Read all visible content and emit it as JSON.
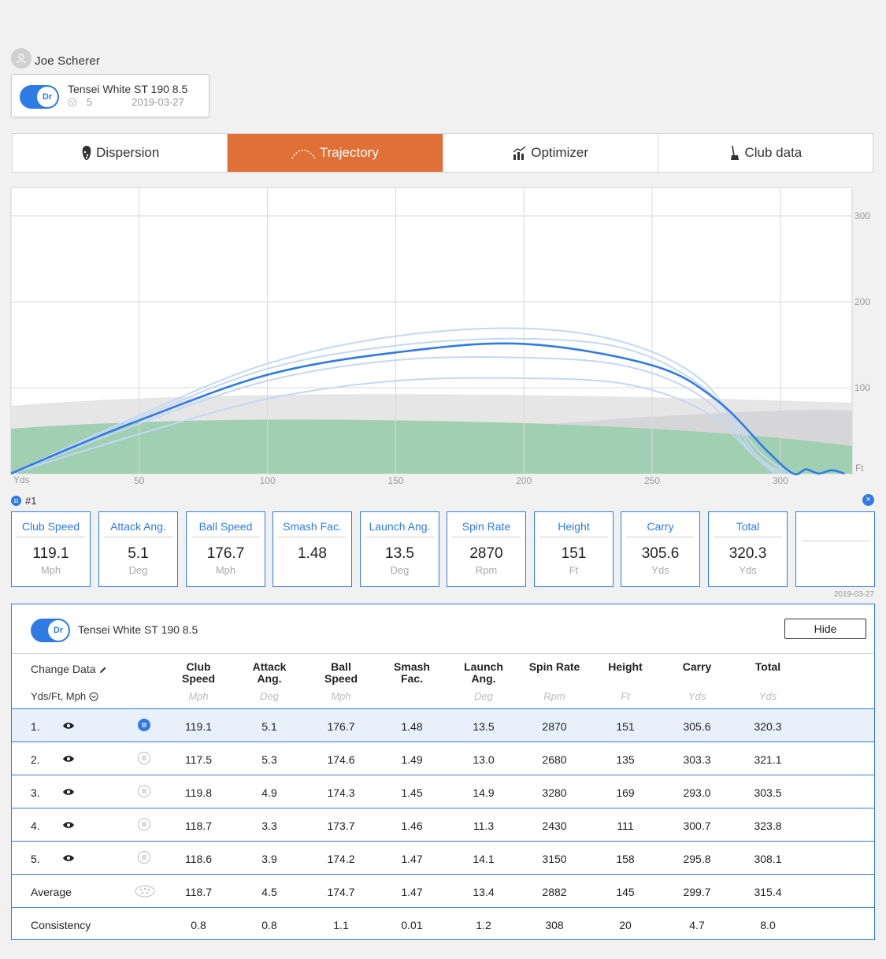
{
  "user": {
    "name": "Joe Scherer"
  },
  "club": {
    "toggle_label": "Dr",
    "name": "Tensei White ST 190 8.5",
    "shot_count": "5",
    "date": "2019-03-27"
  },
  "tabs": [
    {
      "label": "Dispersion",
      "active": false
    },
    {
      "label": "Trajectory",
      "active": true
    },
    {
      "label": "Optimizer",
      "active": false
    },
    {
      "label": "Club data",
      "active": false
    }
  ],
  "chart_data": {
    "type": "line",
    "x_unit_label": "Yds",
    "y_unit_label": "Ft",
    "x_ticks": [
      50,
      100,
      150,
      200,
      250,
      300
    ],
    "y_ticks": [
      100,
      200,
      300
    ],
    "xlim": [
      0,
      328
    ],
    "ylim": [
      0,
      333
    ],
    "highlight_color": "#2f7be6",
    "faded_color": "#c4d8f3",
    "series": [
      {
        "values": [
          [
            0,
            0
          ],
          [
            25,
            32
          ],
          [
            50,
            62
          ],
          [
            100,
            115
          ],
          [
            150,
            141
          ],
          [
            200,
            151
          ],
          [
            250,
            126
          ],
          [
            275,
            86
          ],
          [
            295,
            26
          ],
          [
            305,
            0
          ],
          [
            310,
            5
          ],
          [
            315,
            0
          ],
          [
            320,
            4
          ],
          [
            325,
            0
          ]
        ],
        "highlight": true
      },
      {
        "values": [
          [
            0,
            0
          ],
          [
            50,
            68
          ],
          [
            100,
            128
          ],
          [
            150,
            160
          ],
          [
            200,
            169
          ],
          [
            240,
            152
          ],
          [
            270,
            107
          ],
          [
            290,
            24
          ],
          [
            302,
            0
          ]
        ],
        "highlight": false
      },
      {
        "values": [
          [
            0,
            0
          ],
          [
            50,
            65
          ],
          [
            100,
            122
          ],
          [
            150,
            149
          ],
          [
            200,
            157
          ],
          [
            240,
            145
          ],
          [
            270,
            100
          ],
          [
            292,
            25
          ],
          [
            304,
            0
          ]
        ],
        "highlight": false
      },
      {
        "values": [
          [
            0,
            0
          ],
          [
            50,
            58
          ],
          [
            100,
            108
          ],
          [
            150,
            132
          ],
          [
            200,
            135
          ],
          [
            240,
            125
          ],
          [
            270,
            88
          ],
          [
            290,
            20
          ],
          [
            300,
            0
          ]
        ],
        "highlight": false
      },
      {
        "values": [
          [
            0,
            0
          ],
          [
            50,
            46
          ],
          [
            100,
            87
          ],
          [
            150,
            108
          ],
          [
            200,
            111
          ],
          [
            240,
            104
          ],
          [
            270,
            73
          ],
          [
            290,
            20
          ],
          [
            298,
            0
          ]
        ],
        "highlight": false
      }
    ]
  },
  "shot": {
    "label": "#1",
    "close_icon": "×",
    "date": "2019-03-27",
    "metrics": [
      {
        "label": "Club Speed",
        "value": "119.1",
        "unit": "Mph"
      },
      {
        "label": "Attack Ang.",
        "value": "5.1",
        "unit": "Deg"
      },
      {
        "label": "Ball Speed",
        "value": "176.7",
        "unit": "Mph"
      },
      {
        "label": "Smash Fac.",
        "value": "1.48",
        "unit": ""
      },
      {
        "label": "Launch Ang.",
        "value": "13.5",
        "unit": "Deg"
      },
      {
        "label": "Spin Rate",
        "value": "2870",
        "unit": "Rpm"
      },
      {
        "label": "Height",
        "value": "151",
        "unit": "Ft"
      },
      {
        "label": "Carry",
        "value": "305.6",
        "unit": "Yds"
      },
      {
        "label": "Total",
        "value": "320.3",
        "unit": "Yds"
      }
    ]
  },
  "table": {
    "toggle_label": "Dr",
    "club_name": "Tensei White ST 190 8.5",
    "hide_label": "Hide",
    "change_data_label": "Change Data",
    "units_label": "Yds/Ft, Mph",
    "columns": [
      {
        "l1": "Club",
        "l2": "Speed",
        "unit": "Mph"
      },
      {
        "l1": "Attack",
        "l2": "Ang.",
        "unit": "Deg"
      },
      {
        "l1": "Ball",
        "l2": "Speed",
        "unit": "Mph"
      },
      {
        "l1": "Smash",
        "l2": "Fac.",
        "unit": ""
      },
      {
        "l1": "Launch",
        "l2": "Ang.",
        "unit": "Deg"
      },
      {
        "l1": "Spin Rate",
        "l2": "",
        "unit": "Rpm"
      },
      {
        "l1": "Height",
        "l2": "",
        "unit": "Ft"
      },
      {
        "l1": "Carry",
        "l2": "",
        "unit": "Yds"
      },
      {
        "l1": "Total",
        "l2": "",
        "unit": "Yds"
      }
    ],
    "rows": [
      {
        "idx": "1.",
        "values": [
          "119.1",
          "5.1",
          "176.7",
          "1.48",
          "13.5",
          "2870",
          "151",
          "305.6",
          "320.3"
        ]
      },
      {
        "idx": "2.",
        "values": [
          "117.5",
          "5.3",
          "174.6",
          "1.49",
          "13.0",
          "2680",
          "135",
          "303.3",
          "321.1"
        ]
      },
      {
        "idx": "3.",
        "values": [
          "119.8",
          "4.9",
          "174.3",
          "1.45",
          "14.9",
          "3280",
          "169",
          "293.0",
          "303.5"
        ]
      },
      {
        "idx": "4.",
        "values": [
          "118.7",
          "3.3",
          "173.7",
          "1.46",
          "11.3",
          "2430",
          "111",
          "300.7",
          "323.8"
        ]
      },
      {
        "idx": "5.",
        "values": [
          "118.6",
          "3.9",
          "174.2",
          "1.47",
          "14.1",
          "3150",
          "158",
          "295.8",
          "308.1"
        ]
      }
    ],
    "average": {
      "label": "Average",
      "values": [
        "118.7",
        "4.5",
        "174.7",
        "1.47",
        "13.4",
        "2882",
        "145",
        "299.7",
        "315.4"
      ]
    },
    "consistency": {
      "label": "Consistency",
      "values": [
        "0.8",
        "0.8",
        "1.1",
        "0.01",
        "1.2",
        "308",
        "20",
        "4.7",
        "8.0"
      ]
    }
  }
}
